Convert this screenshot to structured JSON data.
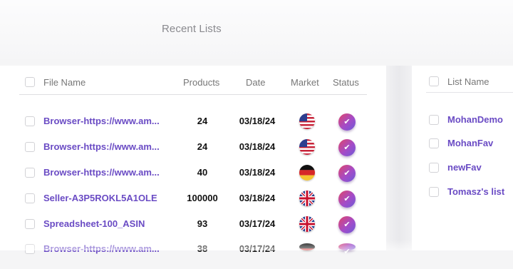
{
  "section_title": "Recent Lists",
  "recent_table": {
    "columns": {
      "file_name": "File Name",
      "products": "Products",
      "date": "Date",
      "market": "Market",
      "status": "Status"
    },
    "rows": [
      {
        "file_name": "Browser-https://www.am...",
        "products": "24",
        "date": "03/18/24",
        "market": "us-flag-icon",
        "status": "✔"
      },
      {
        "file_name": "Browser-https://www.am...",
        "products": "24",
        "date": "03/18/24",
        "market": "us-flag-icon",
        "status": "✔"
      },
      {
        "file_name": "Browser-https://www.am...",
        "products": "40",
        "date": "03/18/24",
        "market": "de-flag-icon",
        "status": "✔"
      },
      {
        "file_name": "Seller-A3P5ROKL5A1OLE",
        "products": "100000",
        "date": "03/18/24",
        "market": "uk-flag-icon",
        "status": "✔"
      },
      {
        "file_name": "Spreadsheet-100_ASIN",
        "products": "93",
        "date": "03/17/24",
        "market": "uk-flag-icon",
        "status": "✔"
      },
      {
        "file_name": "Browser-https://www.am...",
        "products": "38",
        "date": "03/17/24",
        "market": "de-flag-icon",
        "status": "✔"
      }
    ]
  },
  "favorites_table": {
    "column": "List Name",
    "rows": [
      "MohanDemo",
      "MohanFav",
      "newFav",
      "Tomasz's list"
    ]
  },
  "colors": {
    "link": "#6a4bc4",
    "status_gradient_start": "#e0456a",
    "status_gradient_end": "#6d5bd6"
  }
}
